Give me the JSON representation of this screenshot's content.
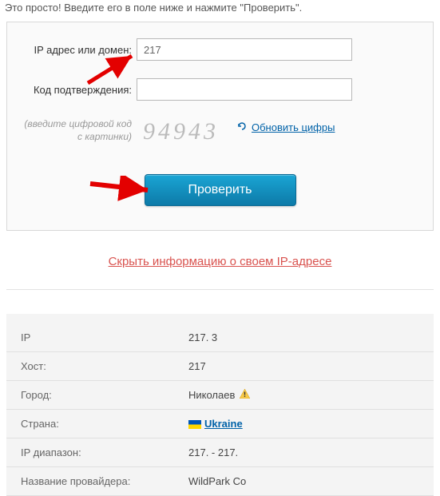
{
  "intro": "Это просто! Введите его в поле ниже и нажмите \"Проверить\".",
  "form": {
    "ip_label": "IP адрес или домен:",
    "ip_value": "217",
    "code_label": "Код подтверждения:",
    "code_value": "",
    "captcha_hint1": "(введите цифровой код",
    "captcha_hint2": "с картинки)",
    "captcha_text": "94943",
    "refresh_label": "Обновить цифры",
    "submit_label": "Проверить"
  },
  "hide_link": "Скрыть информацию о своем IP-адресе",
  "info": {
    "rows": [
      {
        "label": "IP",
        "value": "217.            3"
      },
      {
        "label": "Хост:",
        "value": "217"
      },
      {
        "label": "Город:",
        "value": "Николаев",
        "warn": true
      },
      {
        "label": "Страна:",
        "value": "Ukraine",
        "flag": true,
        "link": true
      },
      {
        "label": "IP диапазон:",
        "value": "217.            - 217."
      },
      {
        "label": "Название провайдера:",
        "value": "WildPark Co"
      }
    ]
  }
}
